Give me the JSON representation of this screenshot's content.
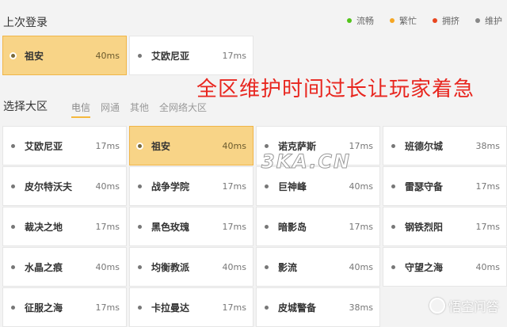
{
  "last_login": {
    "title": "上次登录",
    "servers": [
      {
        "name": "祖安",
        "ping": "40ms",
        "selected": true
      },
      {
        "name": "艾欧尼亚",
        "ping": "17ms",
        "selected": false
      }
    ]
  },
  "legend": [
    {
      "label": "流畅",
      "color": "#52c41a"
    },
    {
      "label": "繁忙",
      "color": "#f5a623"
    },
    {
      "label": "拥挤",
      "color": "#e8461f"
    },
    {
      "label": "维护",
      "color": "#888888"
    }
  ],
  "select_region": {
    "title": "选择大区",
    "tabs": [
      "电信",
      "网通",
      "其他",
      "全网络大区"
    ],
    "active_tab": "电信",
    "servers": [
      {
        "name": "艾欧尼亚",
        "ping": "17ms"
      },
      {
        "name": "祖安",
        "ping": "40ms",
        "selected": true
      },
      {
        "name": "诺克萨斯",
        "ping": "17ms"
      },
      {
        "name": "班德尔城",
        "ping": "38ms"
      },
      {
        "name": "皮尔特沃夫",
        "ping": "40ms"
      },
      {
        "name": "战争学院",
        "ping": "17ms"
      },
      {
        "name": "巨神峰",
        "ping": "40ms"
      },
      {
        "name": "雷瑟守备",
        "ping": "17ms"
      },
      {
        "name": "裁决之地",
        "ping": "17ms"
      },
      {
        "name": "黑色玫瑰",
        "ping": "17ms"
      },
      {
        "name": "暗影岛",
        "ping": "17ms"
      },
      {
        "name": "钢铁烈阳",
        "ping": "17ms"
      },
      {
        "name": "水晶之痕",
        "ping": "40ms"
      },
      {
        "name": "均衡教派",
        "ping": "40ms"
      },
      {
        "name": "影流",
        "ping": "40ms"
      },
      {
        "name": "守望之海",
        "ping": "40ms"
      },
      {
        "name": "征服之海",
        "ping": "17ms"
      },
      {
        "name": "卡拉曼达",
        "ping": "17ms"
      },
      {
        "name": "皮城警备",
        "ping": "38ms"
      }
    ]
  },
  "overlay_caption": "全区维护时间过长让玩家着急",
  "watermark": "3KA.CN",
  "brand": "悟空问答"
}
